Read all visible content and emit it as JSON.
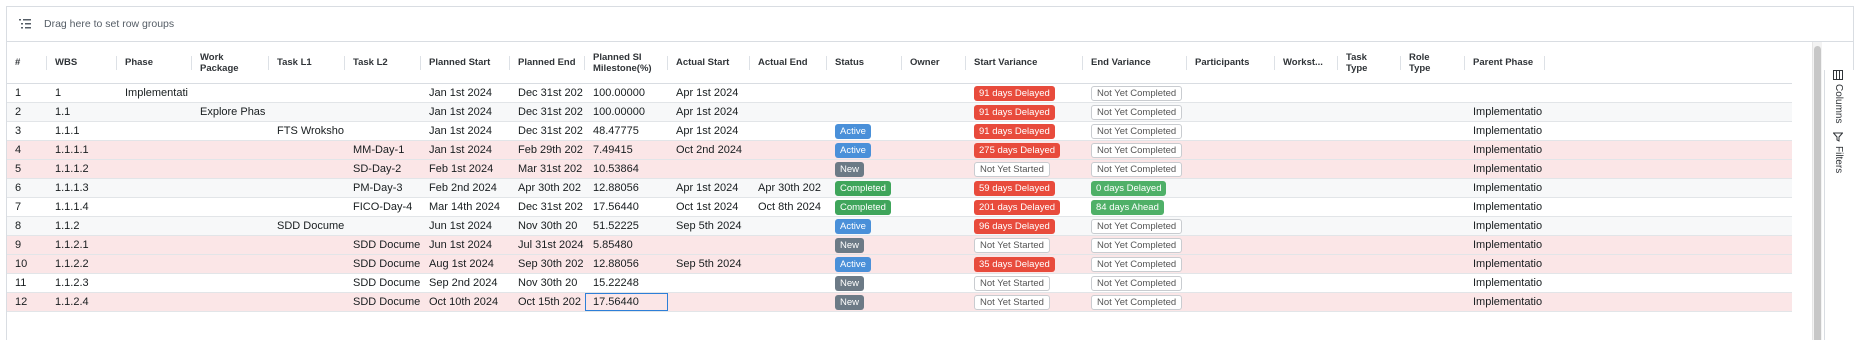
{
  "group_bar": {
    "placeholder": "Drag here to set row groups"
  },
  "columns": [
    {
      "key": "num",
      "label": "#"
    },
    {
      "key": "wbs",
      "label": "WBS"
    },
    {
      "key": "phase",
      "label": "Phase"
    },
    {
      "key": "work_package",
      "label": "Work\nPackage"
    },
    {
      "key": "task_l1",
      "label": "Task L1"
    },
    {
      "key": "task_l2",
      "label": "Task L2"
    },
    {
      "key": "planned_start",
      "label": "Planned Start"
    },
    {
      "key": "planned_end",
      "label": "Planned End"
    },
    {
      "key": "planned_si",
      "label": "Planned SI\nMilestone(%)"
    },
    {
      "key": "actual_start",
      "label": "Actual Start"
    },
    {
      "key": "actual_end",
      "label": "Actual End"
    },
    {
      "key": "status",
      "label": "Status"
    },
    {
      "key": "owner",
      "label": "Owner"
    },
    {
      "key": "start_variance",
      "label": "Start Variance"
    },
    {
      "key": "end_variance",
      "label": "End Variance"
    },
    {
      "key": "participants",
      "label": "Participants"
    },
    {
      "key": "workstream",
      "label": "Workst..."
    },
    {
      "key": "task_type",
      "label": "Task\nType"
    },
    {
      "key": "role_type",
      "label": "Role\nType"
    },
    {
      "key": "parent_phase",
      "label": "Parent Phase"
    }
  ],
  "rows": [
    {
      "num": "1",
      "wbs": "1",
      "phase": "Implementati",
      "work_package": "",
      "task_l1": "",
      "task_l2": "",
      "planned_start": "Jan 1st 2024",
      "planned_end": "Dec 31st 202",
      "planned_si": "100.00000",
      "actual_start": "Apr 1st 2024",
      "actual_end": "",
      "status": "",
      "start_variance": "91 days Delayed",
      "start_variance_kind": "delayed",
      "end_variance": "Not Yet Completed",
      "end_variance_kind": "outline",
      "parent_phase": "",
      "tint": "odd"
    },
    {
      "num": "2",
      "wbs": "1.1",
      "phase": "",
      "work_package": "Explore Phas",
      "task_l1": "",
      "task_l2": "",
      "planned_start": "Jan 1st 2024",
      "planned_end": "Dec 31st 202",
      "planned_si": "100.00000",
      "actual_start": "Apr 1st 2024",
      "actual_end": "",
      "status": "",
      "start_variance": "91 days Delayed",
      "start_variance_kind": "delayed",
      "end_variance": "Not Yet Completed",
      "end_variance_kind": "outline",
      "parent_phase": "Implementatio",
      "tint": "even"
    },
    {
      "num": "3",
      "wbs": "1.1.1",
      "phase": "",
      "work_package": "",
      "task_l1": "FTS Wroksho",
      "task_l2": "",
      "planned_start": "Jan 1st 2024",
      "planned_end": "Dec 31st 202",
      "planned_si": "48.47775",
      "actual_start": "Apr 1st 2024",
      "actual_end": "",
      "status": "Active",
      "status_kind": "active",
      "start_variance": "91 days Delayed",
      "start_variance_kind": "delayed",
      "end_variance": "Not Yet Completed",
      "end_variance_kind": "outline",
      "parent_phase": "Implementatio",
      "tint": "odd"
    },
    {
      "num": "4",
      "wbs": "1.1.1.1",
      "phase": "",
      "work_package": "",
      "task_l1": "",
      "task_l2": "MM-Day-1",
      "planned_start": "Jan 1st 2024",
      "planned_end": "Feb 29th 202",
      "planned_si": "7.49415",
      "actual_start": "Oct 2nd 2024",
      "actual_end": "",
      "status": "Active",
      "status_kind": "active",
      "start_variance": "275 days Delayed",
      "start_variance_kind": "delayed",
      "end_variance": "Not Yet Completed",
      "end_variance_kind": "outline",
      "parent_phase": "Implementatio",
      "tint": "pink"
    },
    {
      "num": "5",
      "wbs": "1.1.1.2",
      "phase": "",
      "work_package": "",
      "task_l1": "",
      "task_l2": "SD-Day-2",
      "planned_start": "Feb 1st 2024",
      "planned_end": "Mar 31st 202",
      "planned_si": "10.53864",
      "actual_start": "",
      "actual_end": "",
      "status": "New",
      "status_kind": "new",
      "start_variance": "Not Yet Started",
      "start_variance_kind": "outline",
      "end_variance": "Not Yet Completed",
      "end_variance_kind": "outline",
      "parent_phase": "Implementatio",
      "tint": "pink"
    },
    {
      "num": "6",
      "wbs": "1.1.1.3",
      "phase": "",
      "work_package": "",
      "task_l1": "",
      "task_l2": "PM-Day-3",
      "planned_start": "Feb 2nd 2024",
      "planned_end": "Apr 30th 202",
      "planned_si": "12.88056",
      "actual_start": "Apr 1st 2024",
      "actual_end": "Apr 30th 202",
      "status": "Completed",
      "status_kind": "completed",
      "start_variance": "59 days Delayed",
      "start_variance_kind": "delayed",
      "end_variance": "0 days Delayed",
      "end_variance_kind": "ahead",
      "parent_phase": "Implementatio",
      "tint": "even"
    },
    {
      "num": "7",
      "wbs": "1.1.1.4",
      "phase": "",
      "work_package": "",
      "task_l1": "",
      "task_l2": "FICO-Day-4",
      "planned_start": "Mar 14th 2024",
      "planned_end": "Dec 31st 202",
      "planned_si": "17.56440",
      "actual_start": "Oct 1st 2024",
      "actual_end": "Oct 8th 2024",
      "status": "Completed",
      "status_kind": "completed",
      "start_variance": "201 days Delayed",
      "start_variance_kind": "delayed",
      "end_variance": "84 days Ahead",
      "end_variance_kind": "ahead",
      "parent_phase": "Implementatio",
      "tint": "odd"
    },
    {
      "num": "8",
      "wbs": "1.1.2",
      "phase": "",
      "work_package": "",
      "task_l1": "SDD Docume",
      "task_l2": "",
      "planned_start": "Jun 1st 2024",
      "planned_end": "Nov 30th 20",
      "planned_si": "51.52225",
      "actual_start": "Sep 5th 2024",
      "actual_end": "",
      "status": "Active",
      "status_kind": "active",
      "start_variance": "96 days Delayed",
      "start_variance_kind": "delayed",
      "end_variance": "Not Yet Completed",
      "end_variance_kind": "outline",
      "parent_phase": "Implementatio",
      "tint": "even"
    },
    {
      "num": "9",
      "wbs": "1.1.2.1",
      "phase": "",
      "work_package": "",
      "task_l1": "",
      "task_l2": "SDD Docume",
      "planned_start": "Jun 1st 2024",
      "planned_end": "Jul 31st 2024",
      "planned_si": "5.85480",
      "actual_start": "",
      "actual_end": "",
      "status": "New",
      "status_kind": "new",
      "start_variance": "Not Yet Started",
      "start_variance_kind": "outline",
      "end_variance": "Not Yet Completed",
      "end_variance_kind": "outline",
      "parent_phase": "Implementatio",
      "tint": "pink"
    },
    {
      "num": "10",
      "wbs": "1.1.2.2",
      "phase": "",
      "work_package": "",
      "task_l1": "",
      "task_l2": "SDD Docume",
      "planned_start": "Aug 1st 2024",
      "planned_end": "Sep 30th 202",
      "planned_si": "12.88056",
      "actual_start": "Sep 5th 2024",
      "actual_end": "",
      "status": "Active",
      "status_kind": "active",
      "start_variance": "35 days Delayed",
      "start_variance_kind": "delayed",
      "end_variance": "Not Yet Completed",
      "end_variance_kind": "outline",
      "parent_phase": "Implementatio",
      "tint": "pink"
    },
    {
      "num": "11",
      "wbs": "1.1.2.3",
      "phase": "",
      "work_package": "",
      "task_l1": "",
      "task_l2": "SDD Docume",
      "planned_start": "Sep 2nd 2024",
      "planned_end": "Nov 30th 20",
      "planned_si": "15.22248",
      "actual_start": "",
      "actual_end": "",
      "status": "New",
      "status_kind": "new",
      "start_variance": "Not Yet Started",
      "start_variance_kind": "outline",
      "end_variance": "Not Yet Completed",
      "end_variance_kind": "outline",
      "parent_phase": "Implementatio",
      "tint": "odd"
    },
    {
      "num": "12",
      "wbs": "1.1.2.4",
      "phase": "",
      "work_package": "",
      "task_l1": "",
      "task_l2": "SDD Docume",
      "planned_start": "Oct 10th 2024",
      "planned_end": "Oct 15th 202",
      "planned_si": "17.56440",
      "actual_start": "",
      "actual_end": "",
      "status": "New",
      "status_kind": "new",
      "start_variance": "Not Yet Started",
      "start_variance_kind": "outline",
      "end_variance": "Not Yet Completed",
      "end_variance_kind": "outline",
      "parent_phase": "Implementatio",
      "tint": "pink",
      "focused": "planned_si"
    }
  ],
  "side_panel": {
    "columns_label": "Columns",
    "filters_label": "Filters"
  },
  "colors": {
    "delayed": "#e84b3c",
    "ahead": "#4fb068",
    "active": "#4a90d9",
    "new": "#6c7a86",
    "completed": "#3fa55b",
    "row_pink": "#fbe6e7",
    "focus": "#2d7fd8"
  },
  "icons": {
    "group_bar": "row-groups-icon",
    "columns": "columns-icon",
    "filters": "filter-icon"
  }
}
